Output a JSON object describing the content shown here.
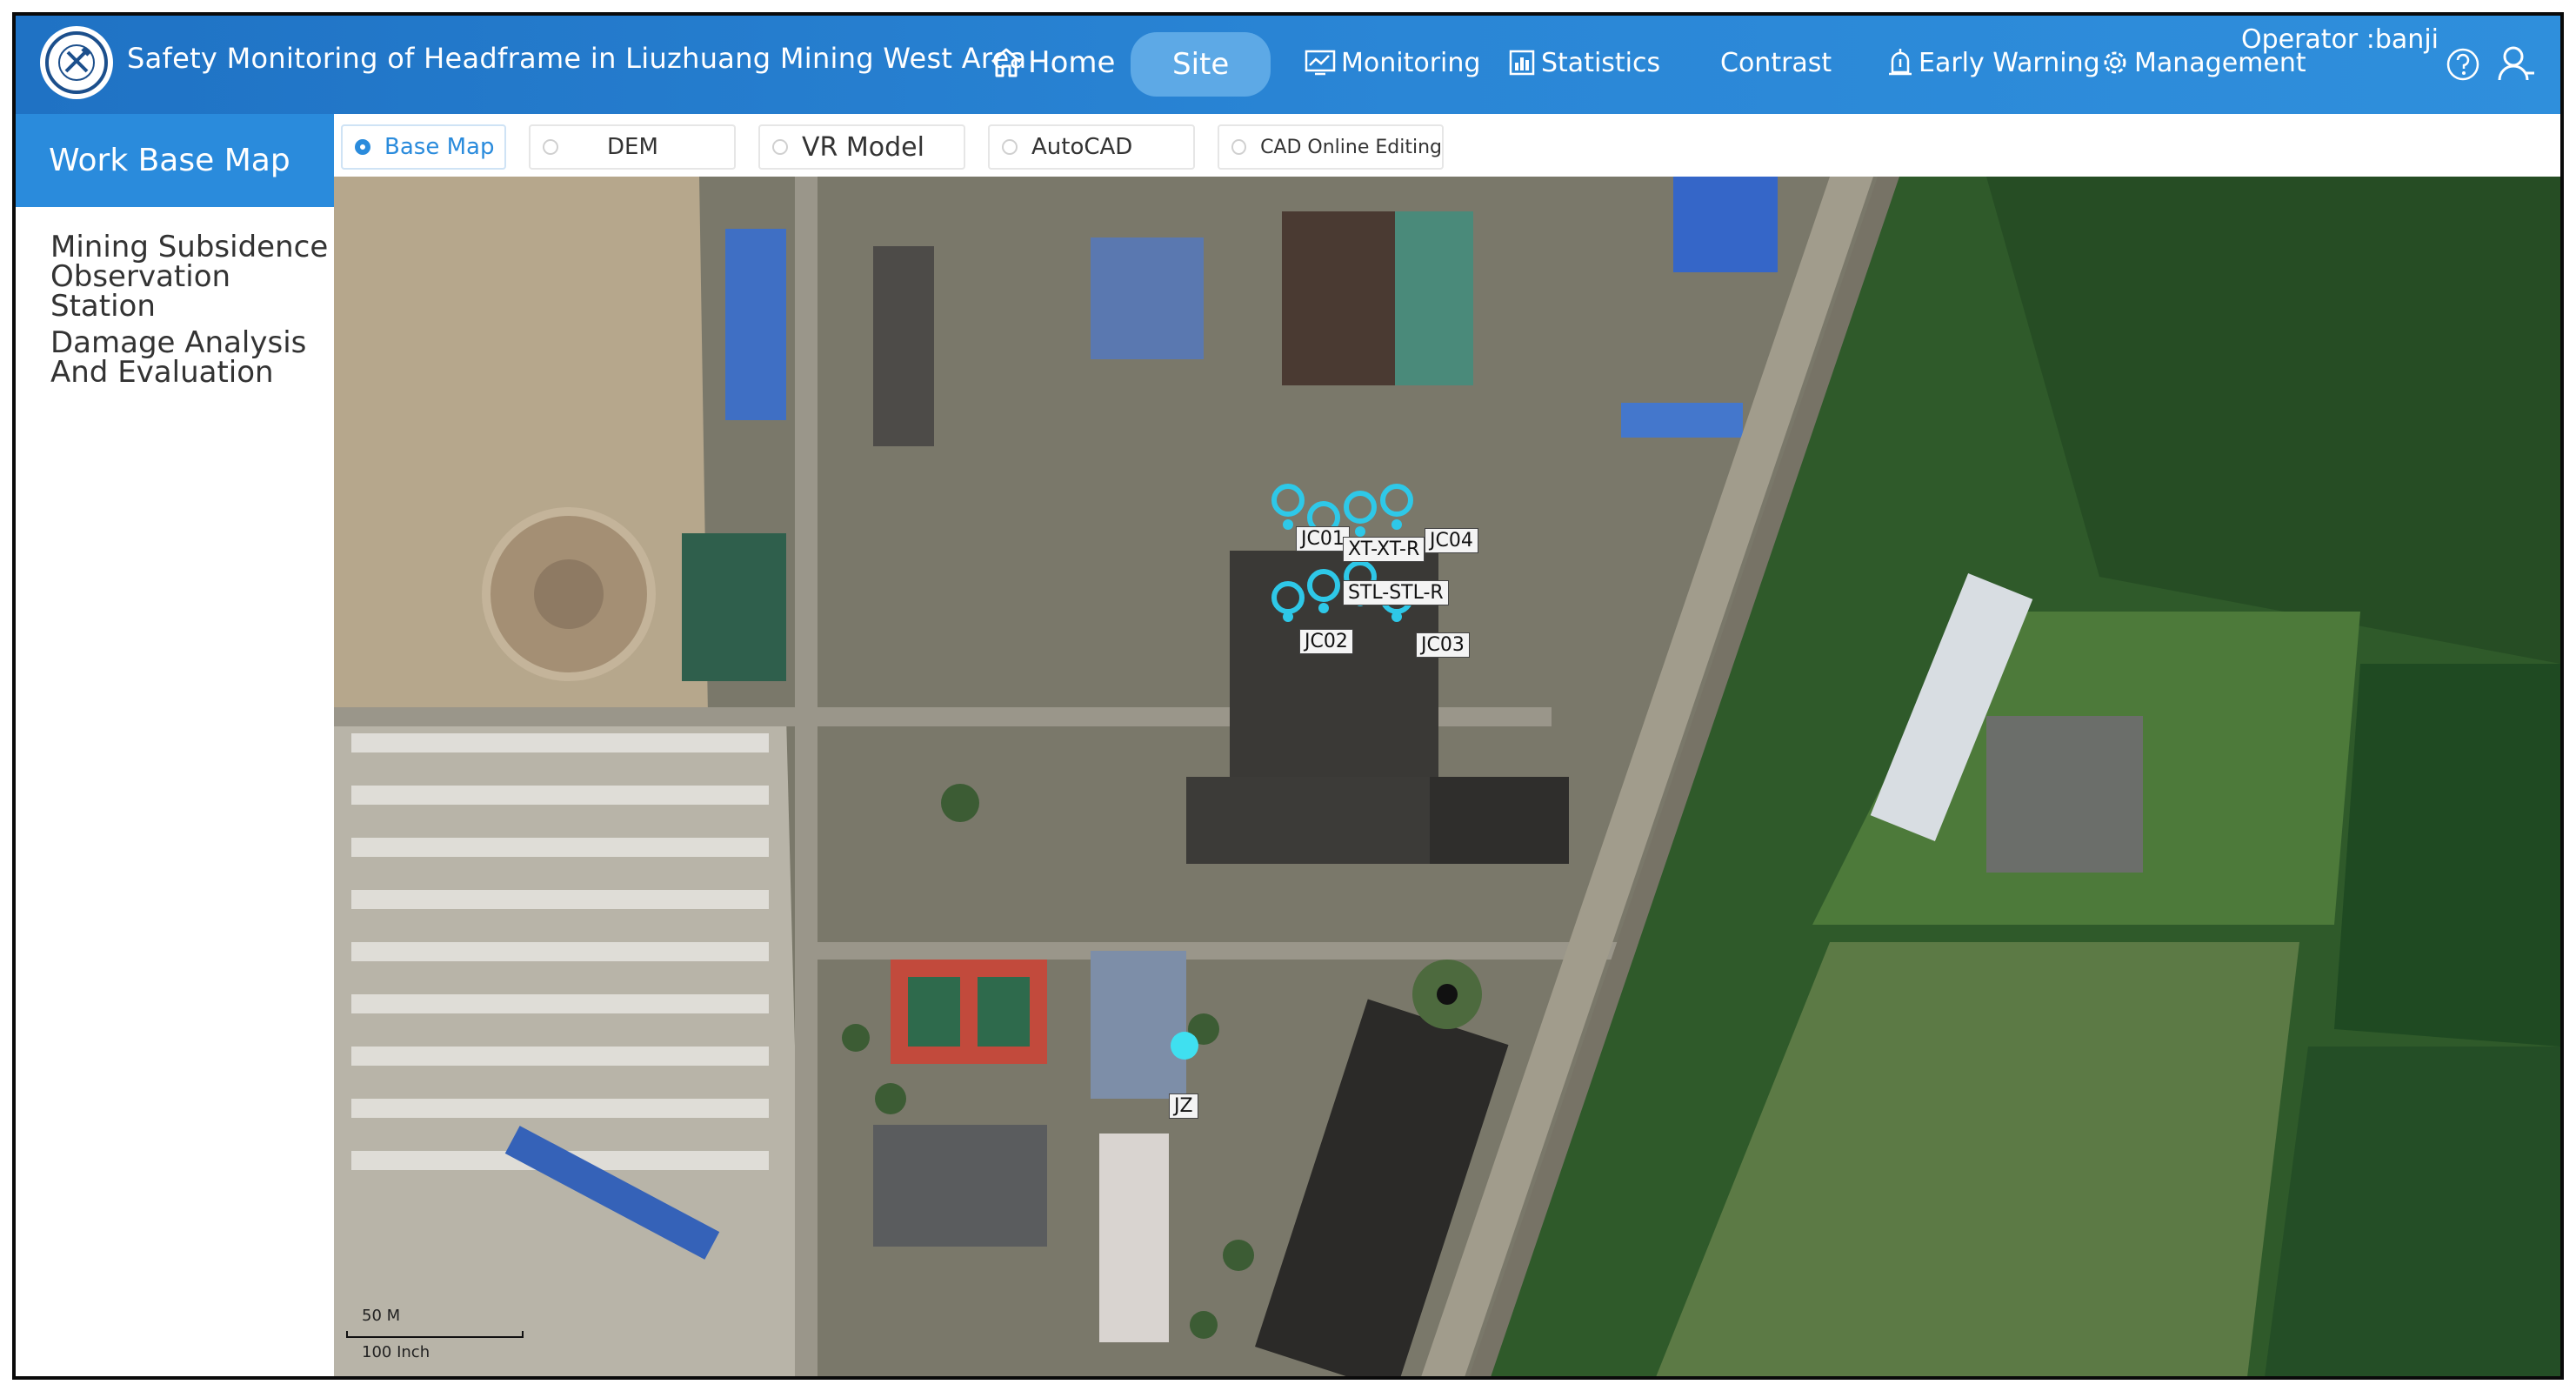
{
  "header": {
    "title": "Safety Monitoring of Headframe in Liuzhuang Mining West Area",
    "nav": [
      {
        "label": "Home",
        "icon": "home-icon"
      },
      {
        "label": "Site",
        "icon": ""
      },
      {
        "label": "Monitoring",
        "icon": "monitoring-icon"
      },
      {
        "label": "Statistics",
        "icon": "statistics-icon"
      },
      {
        "label": "Contrast",
        "icon": ""
      },
      {
        "label": "Early Warning",
        "icon": "alarm-icon"
      },
      {
        "label": "Management",
        "icon": "gear-icon"
      }
    ],
    "active_nav": "Site",
    "operator": "Operator :banji",
    "accent_color": "#2a86d6"
  },
  "sidebar": {
    "items": [
      {
        "label": "Work Base Map"
      },
      {
        "label": "Mining Subsidence Observation Station"
      },
      {
        "label": "Damage Analysis And Evaluation"
      }
    ],
    "active_color": "#2a8bdc"
  },
  "tabs": [
    {
      "label": "Base Map"
    },
    {
      "label": "DEM"
    },
    {
      "label": "VR Model"
    },
    {
      "label": "AutoCAD"
    },
    {
      "label": "CAD Online Editing"
    }
  ],
  "map": {
    "markers": [
      {
        "label": "JC01"
      },
      {
        "label": "XT-XT-R"
      },
      {
        "label": "JC04"
      },
      {
        "label": "STL-STL-R"
      },
      {
        "label": "JC02"
      },
      {
        "label": "JC03"
      },
      {
        "label": "JZ"
      }
    ],
    "scale": {
      "top": "50 M",
      "bottom": "100 Inch"
    },
    "marker_color": "#2ec8e8"
  }
}
